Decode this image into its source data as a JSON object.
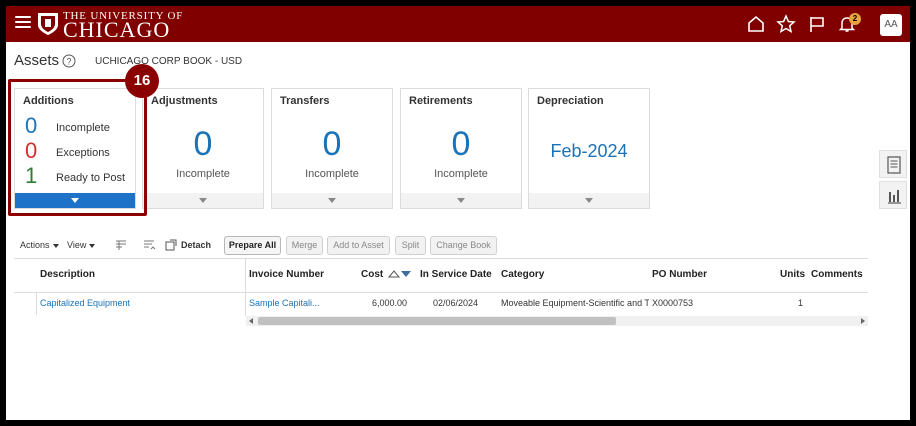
{
  "header": {
    "logo_top": "THE UNIVERSITY OF",
    "logo_main": "CHICAGO",
    "notification_count": "2",
    "avatar_initials": "AA",
    "icons": [
      "menu-icon",
      "home-icon",
      "star-icon",
      "flag-icon",
      "bell-icon"
    ]
  },
  "page": {
    "title": "Assets",
    "book": "UCHICAGO CORP BOOK - USD"
  },
  "annotation": {
    "step": "16"
  },
  "tiles": {
    "additions": {
      "title": "Additions",
      "rows": [
        {
          "count": "0",
          "label": "Incomplete",
          "color": "#1a73b8"
        },
        {
          "count": "0",
          "label": "Exceptions",
          "color": "#d0312d"
        },
        {
          "count": "1",
          "label": "Ready to Post",
          "color": "#2e7d32"
        }
      ]
    },
    "adjustments": {
      "title": "Adjustments",
      "count": "0",
      "label": "Incomplete"
    },
    "transfers": {
      "title": "Transfers",
      "count": "0",
      "label": "Incomplete"
    },
    "retirements": {
      "title": "Retirements",
      "count": "0",
      "label": "Incomplete"
    },
    "depreciation": {
      "title": "Depreciation",
      "period": "Feb-2024"
    }
  },
  "toolbar": {
    "actions": "Actions",
    "view": "View",
    "detach": "Detach",
    "buttons": [
      "Prepare All",
      "Merge",
      "Add to Asset",
      "Split",
      "Change Book"
    ]
  },
  "table": {
    "columns": [
      "Description",
      "Invoice Number",
      "Cost",
      "In Service Date",
      "Category",
      "PO Number",
      "Units",
      "Comments"
    ],
    "rows": [
      {
        "description": "Capitalized Equipment",
        "invoice": "Sample Capitali...",
        "cost": "6,000.00",
        "in_service_date": "02/06/2024",
        "category": "Moveable Equipment-Scientific and Tec",
        "po_number": "X0000753",
        "units": "1",
        "comments": ""
      }
    ]
  },
  "colors": {
    "brand": "#800000",
    "accent": "#1a73b8",
    "highlight": "#8a0000"
  }
}
